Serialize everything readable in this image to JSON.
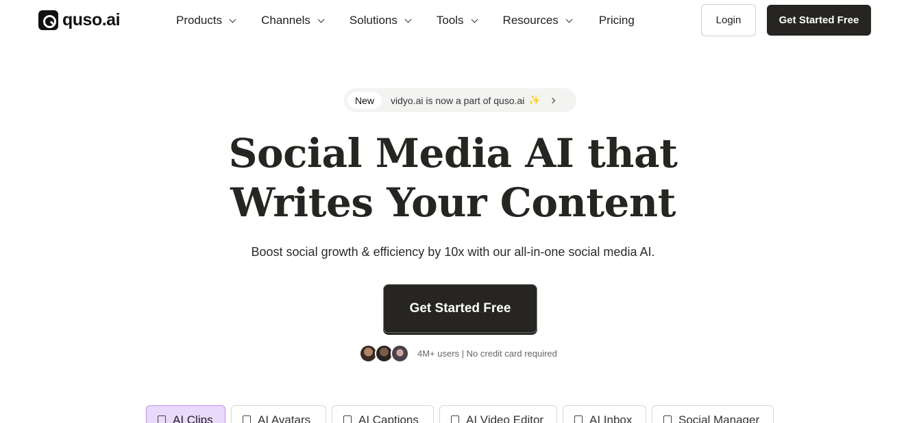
{
  "brand": {
    "name": "quso.ai",
    "logo_icon": "quso-logo-icon"
  },
  "nav": {
    "items": [
      {
        "label": "Products",
        "has_dropdown": true
      },
      {
        "label": "Channels",
        "has_dropdown": true
      },
      {
        "label": "Solutions",
        "has_dropdown": true
      },
      {
        "label": "Tools",
        "has_dropdown": true
      },
      {
        "label": "Resources",
        "has_dropdown": true
      },
      {
        "label": "Pricing",
        "has_dropdown": false
      }
    ],
    "login_label": "Login",
    "cta_label": "Get Started Free"
  },
  "announcement": {
    "badge": "New",
    "text": "vidyo.ai is now a part of quso.ai",
    "emoji": "✨"
  },
  "hero": {
    "title_line1": "Social Media AI that",
    "title_line2": "Writes Your Content",
    "subtitle": "Boost social growth & efficiency by 10x with our all-in-one social media AI.",
    "cta_label": "Get Started Free",
    "proof_text": "4M+ users | No credit card required"
  },
  "tabs": [
    {
      "label": "AI Clips",
      "active": true
    },
    {
      "label": "AI Avatars",
      "active": false
    },
    {
      "label": "AI Captions",
      "active": false
    },
    {
      "label": "AI Video Editor",
      "active": false
    },
    {
      "label": "AI Inbox",
      "active": false
    },
    {
      "label": "Social Manager",
      "active": false
    }
  ],
  "colors": {
    "primary_dark": "#262522",
    "active_tab_bg": "#ead9fb",
    "active_tab_border": "#b992e6",
    "announce_bg": "#f3f3f2"
  }
}
